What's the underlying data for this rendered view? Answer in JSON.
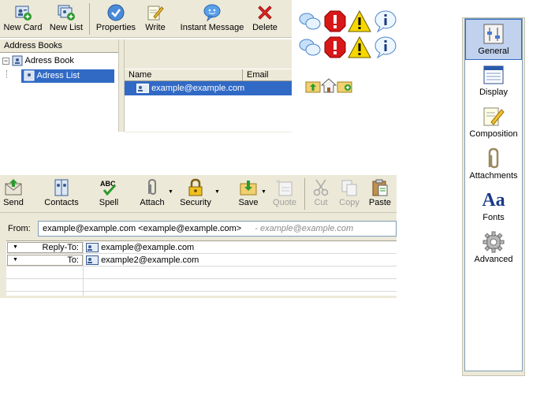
{
  "address_book": {
    "toolbar": [
      {
        "label": "New Card",
        "icon": "new-card-icon"
      },
      {
        "label": "New List",
        "icon": "new-list-icon"
      },
      {
        "label": "Properties",
        "icon": "properties-icon"
      },
      {
        "label": "Write",
        "icon": "write-icon"
      },
      {
        "label": "Instant Message",
        "icon": "instant-message-icon"
      },
      {
        "label": "Delete",
        "icon": "delete-icon"
      }
    ],
    "pane_title": "Address Books",
    "tree": [
      {
        "label": "Adress Book",
        "expander": "−"
      },
      {
        "label": "Adress List"
      }
    ],
    "columns": {
      "name": "Name",
      "email": "Email"
    },
    "rows": [
      {
        "name": "example@example.com"
      }
    ]
  },
  "status_icons": [
    "chat-bubbles-icon",
    "error-stop-icon",
    "warning-icon",
    "info-icon",
    "folder-up-icon",
    "home-icon",
    "folder-new-icon"
  ],
  "compose": {
    "toolbar": [
      {
        "label": "Send",
        "icon": "send-icon",
        "enabled": true
      },
      {
        "label": "Contacts",
        "icon": "contacts-icon",
        "enabled": true
      },
      {
        "label": "Spell",
        "icon": "spell-icon",
        "enabled": true
      },
      {
        "label": "Attach",
        "icon": "attach-icon",
        "enabled": true,
        "menu": true
      },
      {
        "label": "Security",
        "icon": "security-icon",
        "enabled": true,
        "menu": true
      },
      {
        "label": "Save",
        "icon": "save-icon",
        "enabled": true,
        "menu": true
      },
      {
        "label": "Quote",
        "icon": "quote-icon",
        "enabled": false
      },
      {
        "label": "Cut",
        "icon": "cut-icon",
        "enabled": false
      },
      {
        "label": "Copy",
        "icon": "copy-icon",
        "enabled": false
      },
      {
        "label": "Paste",
        "icon": "paste-icon",
        "enabled": true
      }
    ],
    "spell_icon_text": "ABC",
    "from_label": "From:",
    "from_value": "example@example.com <example@example.com>",
    "from_hint": "- example@example.com",
    "recipients": [
      {
        "type": "Reply-To:",
        "value": "example@example.com"
      },
      {
        "type": "To:",
        "value": "example2@example.com"
      }
    ]
  },
  "preferences": {
    "items": [
      {
        "label": "General",
        "icon": "general-icon",
        "selected": true
      },
      {
        "label": "Display",
        "icon": "display-icon"
      },
      {
        "label": "Composition",
        "icon": "composition-icon"
      },
      {
        "label": "Attachments",
        "icon": "attachments-icon"
      },
      {
        "label": "Fonts",
        "icon": "fonts-icon",
        "glyph": "Aa"
      },
      {
        "label": "Advanced",
        "icon": "advanced-icon"
      }
    ]
  },
  "colors": {
    "selection": "#316ac5",
    "toolbar_bg": "#ece9d8"
  }
}
